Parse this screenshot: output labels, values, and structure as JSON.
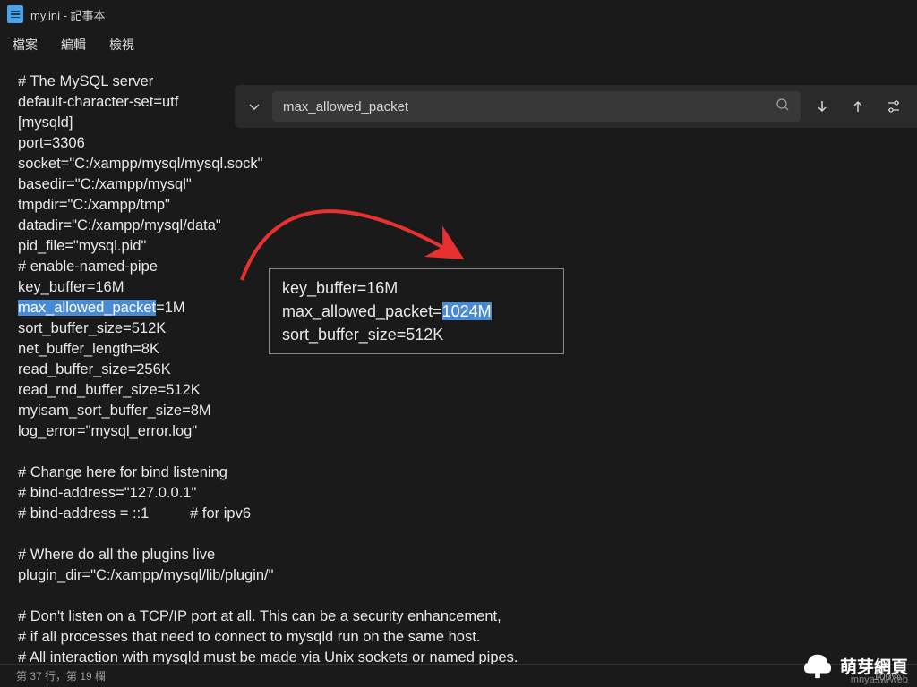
{
  "titlebar": {
    "title": "my.ini - 記事本"
  },
  "menubar": {
    "file": "檔案",
    "edit": "編輯",
    "view": "檢視"
  },
  "find": {
    "value": "max_allowed_packet"
  },
  "content": {
    "lines": [
      "# The MySQL server",
      "default-character-set=utf",
      "[mysqld]",
      "port=3306",
      "socket=\"C:/xampp/mysql/mysql.sock\"",
      "basedir=\"C:/xampp/mysql\"",
      "tmpdir=\"C:/xampp/tmp\"",
      "datadir=\"C:/xampp/mysql/data\"",
      "pid_file=\"mysql.pid\"",
      "# enable-named-pipe",
      "key_buffer=16M"
    ],
    "highlighted_pre": "",
    "highlighted": "max_allowed_packet",
    "highlighted_post": "=1M",
    "lines_after": [
      "sort_buffer_size=512K",
      "net_buffer_length=8K",
      "read_buffer_size=256K",
      "read_rnd_buffer_size=512K",
      "myisam_sort_buffer_size=8M",
      "log_error=\"mysql_error.log\"",
      "",
      "# Change here for bind listening",
      "# bind-address=\"127.0.0.1\"",
      "# bind-address = ::1          # for ipv6",
      "",
      "# Where do all the plugins live",
      "plugin_dir=\"C:/xampp/mysql/lib/plugin/\"",
      "",
      "# Don't listen on a TCP/IP port at all. This can be a security enhancement,",
      "# if all processes that need to connect to mysqld run on the same host.",
      "# All interaction with mysqld must be made via Unix sockets or named pipes."
    ]
  },
  "callout": {
    "line1": "key_buffer=16M",
    "line2_pre": "max_allowed_packet=",
    "line2_highlight": "1024M",
    "line3": "sort_buffer_size=512K"
  },
  "statusbar": {
    "position": "第 37 行，第 19 欄",
    "zoom": "100%"
  },
  "watermark": {
    "text": "萌芽網頁",
    "url": "mnya.tw/web"
  }
}
